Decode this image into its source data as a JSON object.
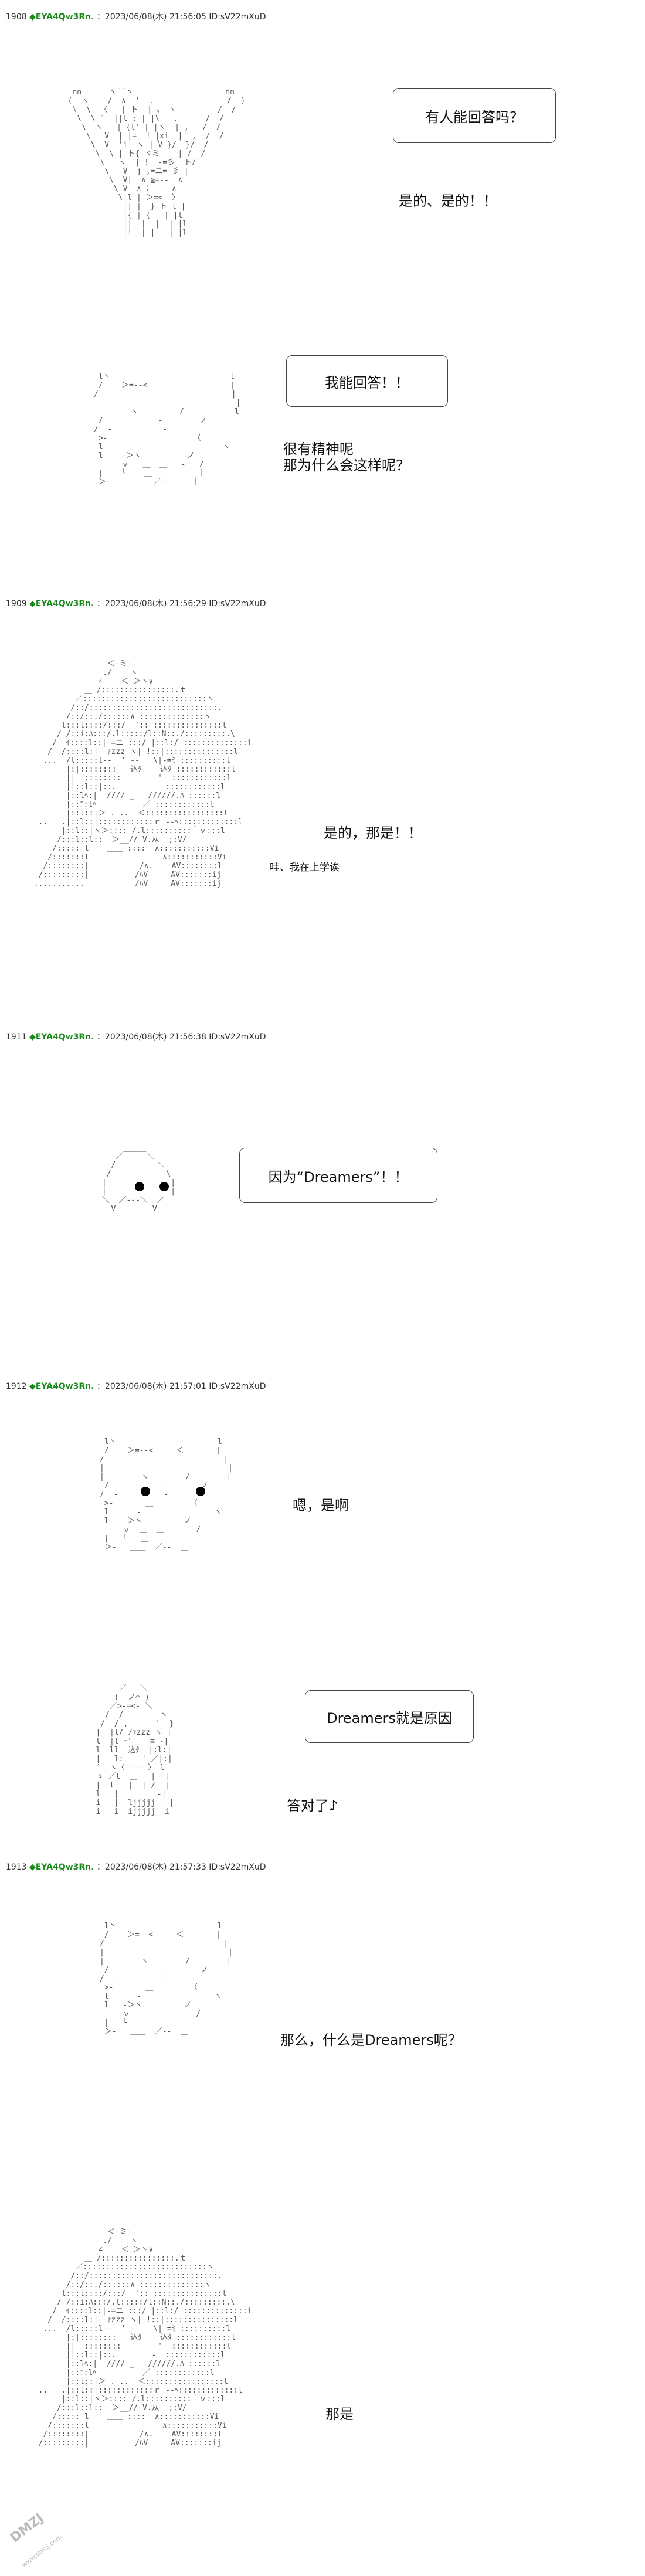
{
  "posts": [
    {
      "num": "1908",
      "trip": "◆EYA4Qw3Rn.",
      "meta": "：2023/06/08(木) 21:56:05 ID:sV22mXuD"
    },
    {
      "num": "1909",
      "trip": "◆EYA4Qw3Rn.",
      "meta": "：2023/06/08(木) 21:56:29 ID:sV22mXuD"
    },
    {
      "num": "1911",
      "trip": "◆EYA4Qw3Rn.",
      "meta": "：2023/06/08(木) 21:56:38 ID:sV22mXuD"
    },
    {
      "num": "1912",
      "trip": "◆EYA4Qw3Rn.",
      "meta": "：2023/06/08(木) 21:57:01 ID:sV22mXuD"
    },
    {
      "num": "1913",
      "trip": "◆EYA4Qw3Rn.",
      "meta": "：2023/06/08(木) 21:57:33 ID:sV22mXuD"
    }
  ],
  "bubbles": {
    "b1": "有人能回答吗？",
    "b2": "我能回答！！",
    "b3": "因为“Dreamers”！！",
    "b4": "Dreamers就是原因"
  },
  "captions": {
    "c1": "是的、是的！！",
    "c2a": "很有精神呢",
    "c2b": "那为什么会这样呢？",
    "c3": "是的，那是！！",
    "c3small": "哇、我在上学诶",
    "c4": "嗯，是啊",
    "c5": "答对了♪",
    "c6": "那么，什么是Dreamers呢？",
    "c7": "那是"
  },
  "watermark": {
    "main": "DMZJ",
    "sub": "www.dmzj.com"
  }
}
